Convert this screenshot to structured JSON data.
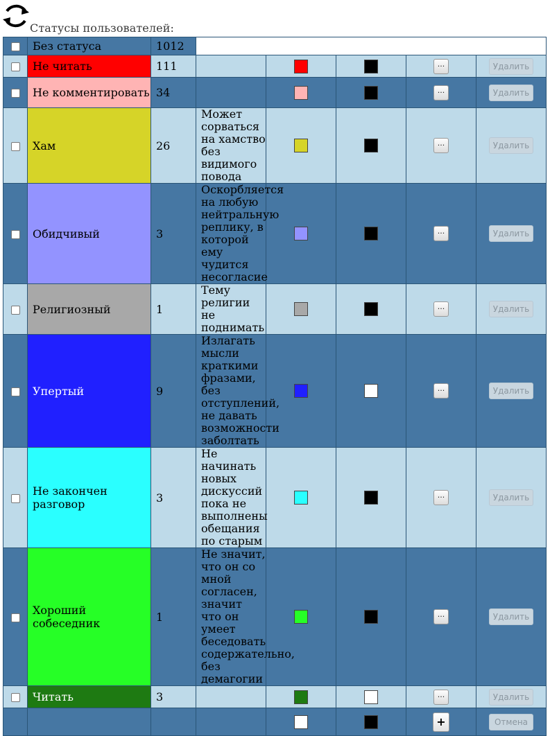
{
  "header": {
    "caption": "Статусы пользователей:",
    "refresh_icon": "refresh-icon"
  },
  "rows": [
    {
      "name": "Без статуса",
      "count": "1012",
      "description": "",
      "color": "",
      "text_color": ""
    },
    {
      "name": "Не читать",
      "count": "111",
      "description": "",
      "color": "#ff0000",
      "text_color": "#000000",
      "delete_label": "Удалить"
    },
    {
      "name": "Не комментировать",
      "count": "34",
      "description": "",
      "color": "#ffb4b4",
      "text_color": "#000000",
      "delete_label": "Удалить"
    },
    {
      "name": "Хам",
      "count": "26",
      "description": "Может сорваться на хамство без видимого повода",
      "color": "#d6d428",
      "text_color": "#000000",
      "delete_label": "Удалить"
    },
    {
      "name": "Обидчивый",
      "count": "3",
      "description": "Оскорбляется на любую нейтральную реплику, в которой ему чудится несогласие",
      "color": "#9393ff",
      "text_color": "#000000",
      "delete_label": "Удалить"
    },
    {
      "name": "Религиозный",
      "count": "1",
      "description": "Тему религии не поднимать",
      "color": "#a8a8a8",
      "text_color": "#000000",
      "delete_label": "Удалить"
    },
    {
      "name": "Упертый",
      "count": "9",
      "description": "Излагать мысли краткими фразами, без отступлений, не давать возможности заболтать",
      "color": "#2020ff",
      "text_color": "#ffffff",
      "delete_label": "Удалить"
    },
    {
      "name": "Не закончен разговор",
      "count": "3",
      "description": "Не начинать новых дискуссий пока не выполнены обещания по старым",
      "color": "#2affff",
      "text_color": "#000000",
      "delete_label": "Удалить"
    },
    {
      "name": "Хороший собеседник",
      "count": "1",
      "description": "Не значит, что он со мной согласен, значит что он умеет беседовать содержательно, без демагогии",
      "color": "#26ff26",
      "text_color": "#000000",
      "delete_label": "Удалить"
    },
    {
      "name": "Читать",
      "count": "3",
      "description": "",
      "color": "#1e7a12",
      "text_color": "#ffffff",
      "delete_label": "Удалить"
    }
  ],
  "new_row": {
    "color": "#ffffff",
    "text_color": "#000000",
    "add_label": "+",
    "cancel_label": "Отмена"
  },
  "edit_label": "..."
}
